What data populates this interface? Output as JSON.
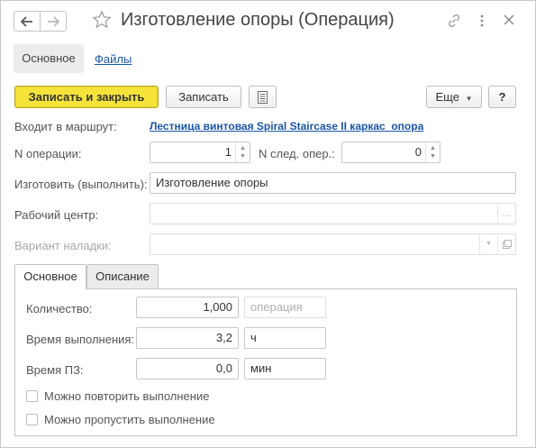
{
  "window": {
    "title": "Изготовление опоры (Операция)"
  },
  "page_tabs": {
    "main": "Основное",
    "files": "Файлы"
  },
  "toolbar": {
    "save_close": "Записать и закрыть",
    "save": "Записать",
    "more": "Еще",
    "help": "?"
  },
  "form": {
    "route_label": "Входит в маршрут:",
    "route_value": "Лестница винтовая Spiral Staircase II каркас_опора",
    "op_number_label": "N операции:",
    "op_number_value": "1",
    "next_op_label": "N след. опер.:",
    "next_op_value": "0",
    "manufacture_label": "Изготовить (выполнить):",
    "manufacture_value": "Изготовление опоры",
    "work_center_label": "Рабочий центр:",
    "work_center_value": "",
    "setup_variant_label": "Вариант наладки:",
    "setup_variant_value": ""
  },
  "inner_tabs": {
    "main": "Основное",
    "description": "Описание"
  },
  "details": {
    "quantity_label": "Количество:",
    "quantity_value": "1,000",
    "quantity_unit_placeholder": "операция",
    "exec_time_label": "Время выполнения:",
    "exec_time_value": "3,2",
    "exec_time_unit": "ч",
    "pz_time_label": "Время ПЗ:",
    "pz_time_value": "0,0",
    "pz_time_unit": "мин",
    "repeat_label": "Можно повторить выполнение",
    "repeat_checked": false,
    "skip_label": "Можно пропустить выполнение",
    "skip_checked": false
  },
  "icons": {
    "back": "arrow-left-icon",
    "forward": "arrow-right-icon",
    "favorite": "star-icon",
    "link": "link-icon",
    "menu": "more-vertical-icon",
    "close": "close-icon",
    "list": "list-icon",
    "dropdown": "chevron-down-icon",
    "ellipsis": "ellipsis-icon",
    "open": "open-icon"
  },
  "colors": {
    "primary_button": "#f5e33a",
    "link": "#1a55a8"
  }
}
